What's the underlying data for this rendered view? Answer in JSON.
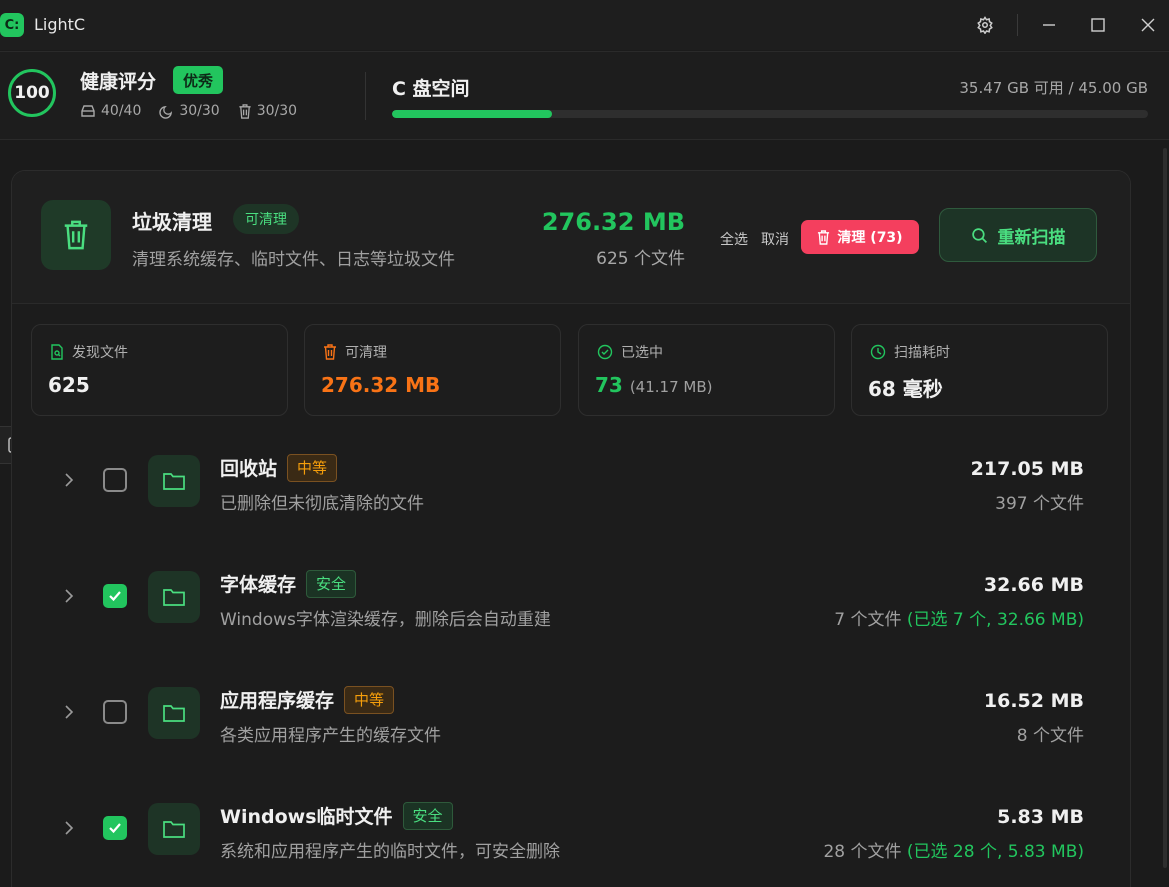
{
  "app": {
    "logo_text": "C:",
    "title": "LightC"
  },
  "health": {
    "score": "100",
    "title": "健康评分",
    "badge": "优秀",
    "stats": [
      {
        "icon": "drive-icon",
        "value": "40/40"
      },
      {
        "icon": "clock-icon",
        "value": "30/30"
      },
      {
        "icon": "trash-icon",
        "value": "30/30"
      }
    ]
  },
  "disk": {
    "title": "C 盘空间",
    "info": "35.47 GB 可用 / 45.00 GB",
    "used_fraction": 0.212
  },
  "cleaner": {
    "title": "垃圾清理",
    "badge": "可清理",
    "desc": "清理系统缓存、临时文件、日志等垃圾文件",
    "total_size": "276.32 MB",
    "total_files": "625 个文件",
    "select_all": "全选",
    "cancel": "取消",
    "clean_button": "清理 (73)",
    "rescan_button": "重新扫描"
  },
  "stats": [
    {
      "label": "发现文件",
      "value": "625",
      "sub": "",
      "color": "#f0f0f0",
      "icon_color": "#22c55e"
    },
    {
      "label": "可清理",
      "value": "276.32 MB",
      "sub": "",
      "color": "#f97316",
      "icon_color": "#f97316"
    },
    {
      "label": "已选中",
      "value": "73",
      "sub": "(41.17 MB)",
      "color": "#22c55e",
      "icon_color": "#22c55e"
    },
    {
      "label": "扫描耗时",
      "value": "68 毫秒",
      "sub": "",
      "color": "#f0f0f0",
      "icon_color": "#22c55e"
    }
  ],
  "items": [
    {
      "title": "回收站",
      "badge": "中等",
      "level": "mid",
      "desc": "已删除但未彻底清除的文件",
      "size": "217.05 MB",
      "files": "397 个文件",
      "selected": "",
      "checked": false
    },
    {
      "title": "字体缓存",
      "badge": "安全",
      "level": "safe",
      "desc": "Windows字体渲染缓存，删除后会自动重建",
      "size": "32.66 MB",
      "files": "7 个文件",
      "selected": "(已选 7 个, 32.66 MB)",
      "checked": true
    },
    {
      "title": "应用程序缓存",
      "badge": "中等",
      "level": "mid",
      "desc": "各类应用程序产生的缓存文件",
      "size": "16.52 MB",
      "files": "8 个文件",
      "selected": "",
      "checked": false
    },
    {
      "title": "Windows临时文件",
      "badge": "安全",
      "level": "safe",
      "desc": "系统和应用程序产生的临时文件，可安全删除",
      "size": "5.83 MB",
      "files": "28 个文件",
      "selected": "(已选 28 个, 5.83 MB)",
      "checked": true
    }
  ]
}
